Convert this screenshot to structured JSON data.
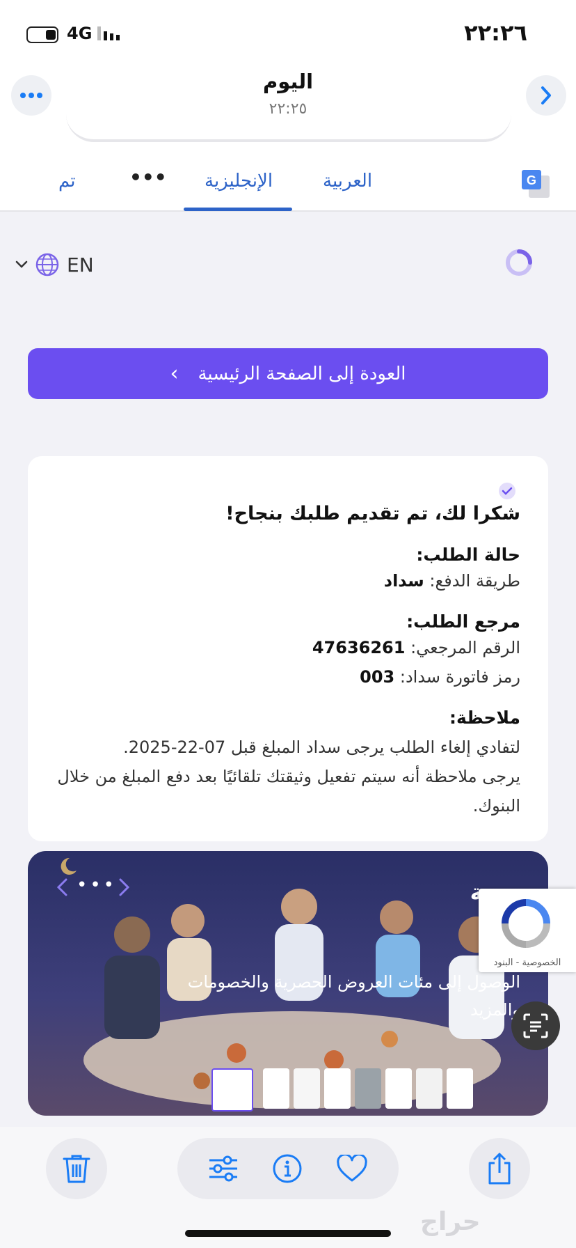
{
  "status_bar": {
    "time": "٢٢:٢٦",
    "network": "4G"
  },
  "header": {
    "title": "اليوم",
    "subtitle": "٢٢:٢٥"
  },
  "translate_tabs": {
    "done": "تم",
    "more": "•••",
    "english": "الإنجليزية",
    "arabic": "العربية"
  },
  "page": {
    "language": "EN",
    "home_button": "العودة إلى الصفحة الرئيسية",
    "home_chevron": "‹",
    "card": {
      "title": "شكرا لك، تم تقديم طلبك بنجاح!",
      "status_heading": "حالة الطلب:",
      "payment_label": "طريقة الدفع:",
      "payment_value": "سداد",
      "reference_heading": "مرجع الطلب:",
      "ref_number_label": "الرقم المرجعي:",
      "ref_number_value": "47636261",
      "sadad_code_label": "رمز فاتورة سداد:",
      "sadad_code_value": "003",
      "note_heading": "ملاحظة:",
      "note_line1": "لتفادي إلغاء الطلب يرجى سداد المبلغ قبل 07-22-2025.",
      "note_line2": "يرجى ملاحظة أنه سيتم تفعيل وثيقتك تلقائيًا بعد دفع المبلغ من خلال البنوك."
    },
    "banner": {
      "title_fragment": "ونية",
      "text_line1": "الوصول إلى مئات العروض الحصرية والخصومات",
      "text_line2": "والمزيد",
      "carousel_dots": "•••"
    },
    "recaptcha_text": "الخصوصية - البنود"
  },
  "watermark": "حراج",
  "colors": {
    "accent": "#6b4ef0",
    "link": "#2d63c8",
    "ios_blue": "#1a7cf5"
  },
  "icons": [
    "ellipsis-icon",
    "chevron-right-icon",
    "translate-icon",
    "globe-icon",
    "chevron-down-icon",
    "loader-icon",
    "check-badge-icon",
    "recaptcha-icon",
    "scan-text-icon",
    "trash-icon",
    "adjust-icon",
    "info-icon",
    "heart-icon",
    "share-icon"
  ]
}
